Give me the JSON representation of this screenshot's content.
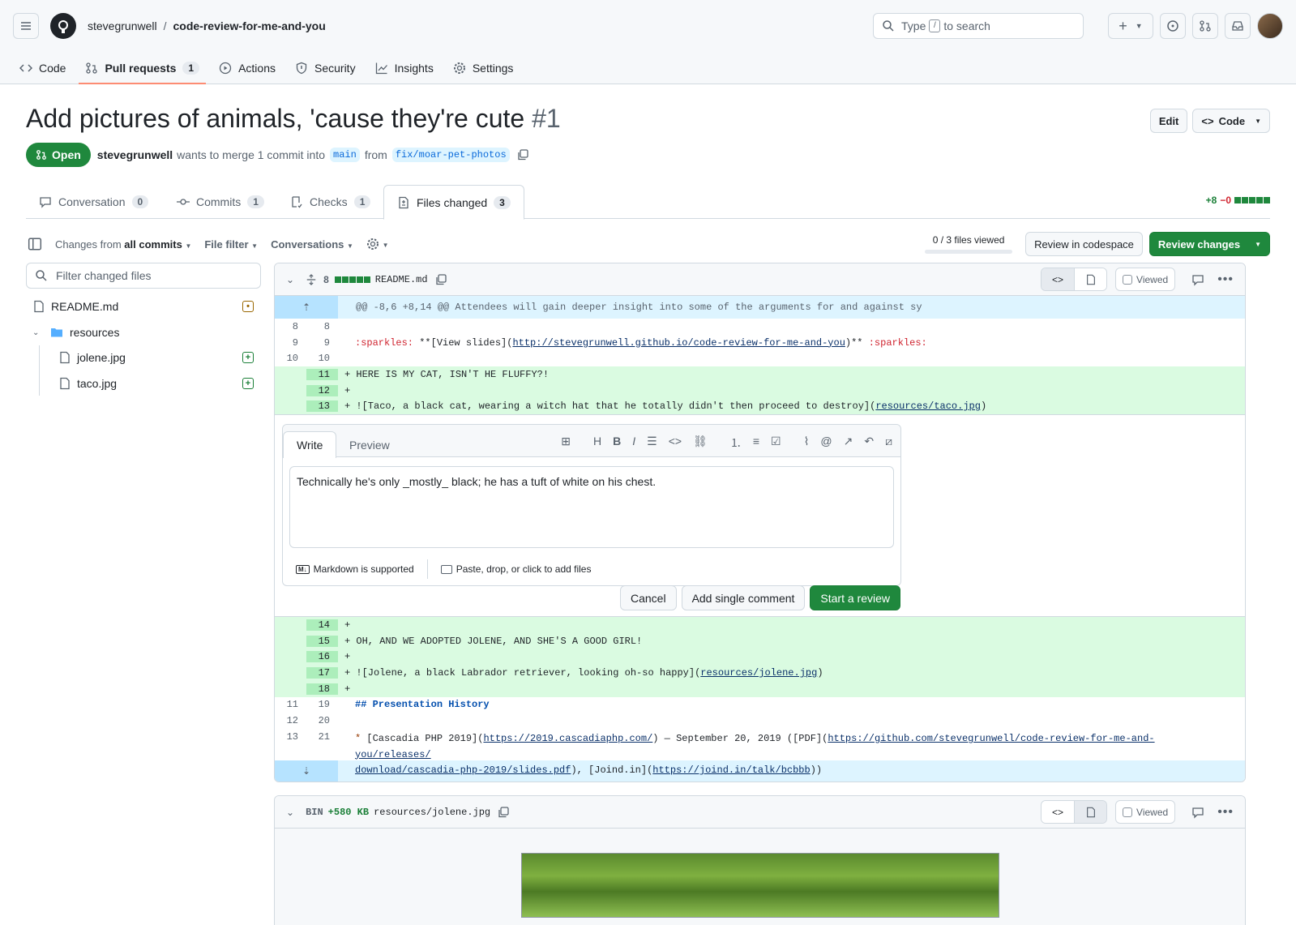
{
  "header": {
    "owner": "stevegrunwell",
    "repo": "code-review-for-me-and-you",
    "search_pre": "Type",
    "search_key": "/",
    "search_post": "to search"
  },
  "nav": [
    {
      "label": "Code",
      "count": ""
    },
    {
      "label": "Pull requests",
      "count": "1"
    },
    {
      "label": "Actions",
      "count": ""
    },
    {
      "label": "Security",
      "count": ""
    },
    {
      "label": "Insights",
      "count": ""
    },
    {
      "label": "Settings",
      "count": ""
    }
  ],
  "pr": {
    "title": "Add pictures of animals, 'cause they're cute",
    "number": "#1",
    "edit_label": "Edit",
    "code_label": "Code",
    "state": "Open",
    "author": "stevegrunwell",
    "merge_text": "wants to merge 1 commit into",
    "base": "main",
    "from_text": "from",
    "head": "fix/moar-pet-photos"
  },
  "tabs": [
    {
      "label": "Conversation",
      "count": "0"
    },
    {
      "label": "Commits",
      "count": "1"
    },
    {
      "label": "Checks",
      "count": "1"
    },
    {
      "label": "Files changed",
      "count": "3"
    }
  ],
  "diffstat": {
    "add": "+8",
    "del": "−0"
  },
  "toolbar": {
    "changes_from": "Changes from",
    "all_commits": "all commits",
    "file_filter": "File filter",
    "conversations": "Conversations",
    "viewed": "0 / 3 files viewed",
    "codespace": "Review in codespace",
    "review": "Review changes"
  },
  "sidebar": {
    "filter_placeholder": "Filter changed files",
    "files": [
      "README.md",
      "resources",
      "jolene.jpg",
      "taco.jpg"
    ]
  },
  "file1": {
    "count": "8",
    "name": "README.md",
    "viewed": "Viewed",
    "hunk": "@@ -8,6 +8,14 @@ Attendees will gain deeper insight into some of the arguments for and against sy",
    "l8": {
      "o": "8",
      "n": "8",
      "t": ""
    },
    "l9": {
      "o": "9",
      "n": "9",
      "pre": ":sparkles:",
      "mid": " **[View slides](",
      "url": "http://stevegrunwell.github.io/code-review-for-me-and-you",
      "post": ")** ",
      "emo": ":sparkles:"
    },
    "l10": {
      "o": "10",
      "n": "10"
    },
    "a11": {
      "n": "11",
      "t": "+ HERE IS MY CAT, ISN'T HE FLUFFY?!"
    },
    "a12": {
      "n": "12",
      "t": "+"
    },
    "a13": {
      "n": "13",
      "pre": "+ ![Taco, a black cat, wearing a witch hat that he totally didn't then proceed to destroy](",
      "url": "resources/taco.jpg",
      "post": ")"
    },
    "a14": {
      "n": "14",
      "t": "+"
    },
    "a15": {
      "n": "15",
      "t": "+ OH, AND WE ADOPTED JOLENE, AND SHE'S A GOOD GIRL!"
    },
    "a16": {
      "n": "16",
      "t": "+"
    },
    "a17": {
      "n": "17",
      "pre": "+ ![Jolene, a black Labrador retriever, looking oh-so happy](",
      "url": "resources/jolene.jpg",
      "post": ")"
    },
    "a18": {
      "n": "18",
      "t": "+"
    },
    "c19": {
      "o": "11",
      "n": "19",
      "t": "## Presentation History"
    },
    "c20": {
      "o": "12",
      "n": "20"
    },
    "c21": {
      "o": "13",
      "n": "21",
      "star": "*",
      "pre": " [Cascadia PHP 2019](",
      "url1": "https://2019.cascadiaphp.com/",
      "mid": ") — September 20, 2019 ([PDF](",
      "url2": "https://github.com/stevegrunwell/code-review-for-me-and-you/releases/",
      "url3": "download/cascadia-php-2019/slides.pdf",
      "mid2": "), [Joind.in](",
      "url4": "https://joind.in/talk/bcbbb",
      "post": "))"
    }
  },
  "comment": {
    "write": "Write",
    "preview": "Preview",
    "text": "Technically he's only _mostly_ black; he has a tuft of white on his chest.",
    "markdown": "Markdown is supported",
    "files": "Paste, drop, or click to add files",
    "cancel": "Cancel",
    "single": "Add single comment",
    "start": "Start a review"
  },
  "file2": {
    "bin": "BIN",
    "size": "+580 KB",
    "name": "resources/jolene.jpg",
    "viewed": "Viewed"
  },
  "colors": {
    "accent": "#1f883d",
    "add_bg": "#dafbe1",
    "hunk_bg": "#ddf4ff"
  }
}
